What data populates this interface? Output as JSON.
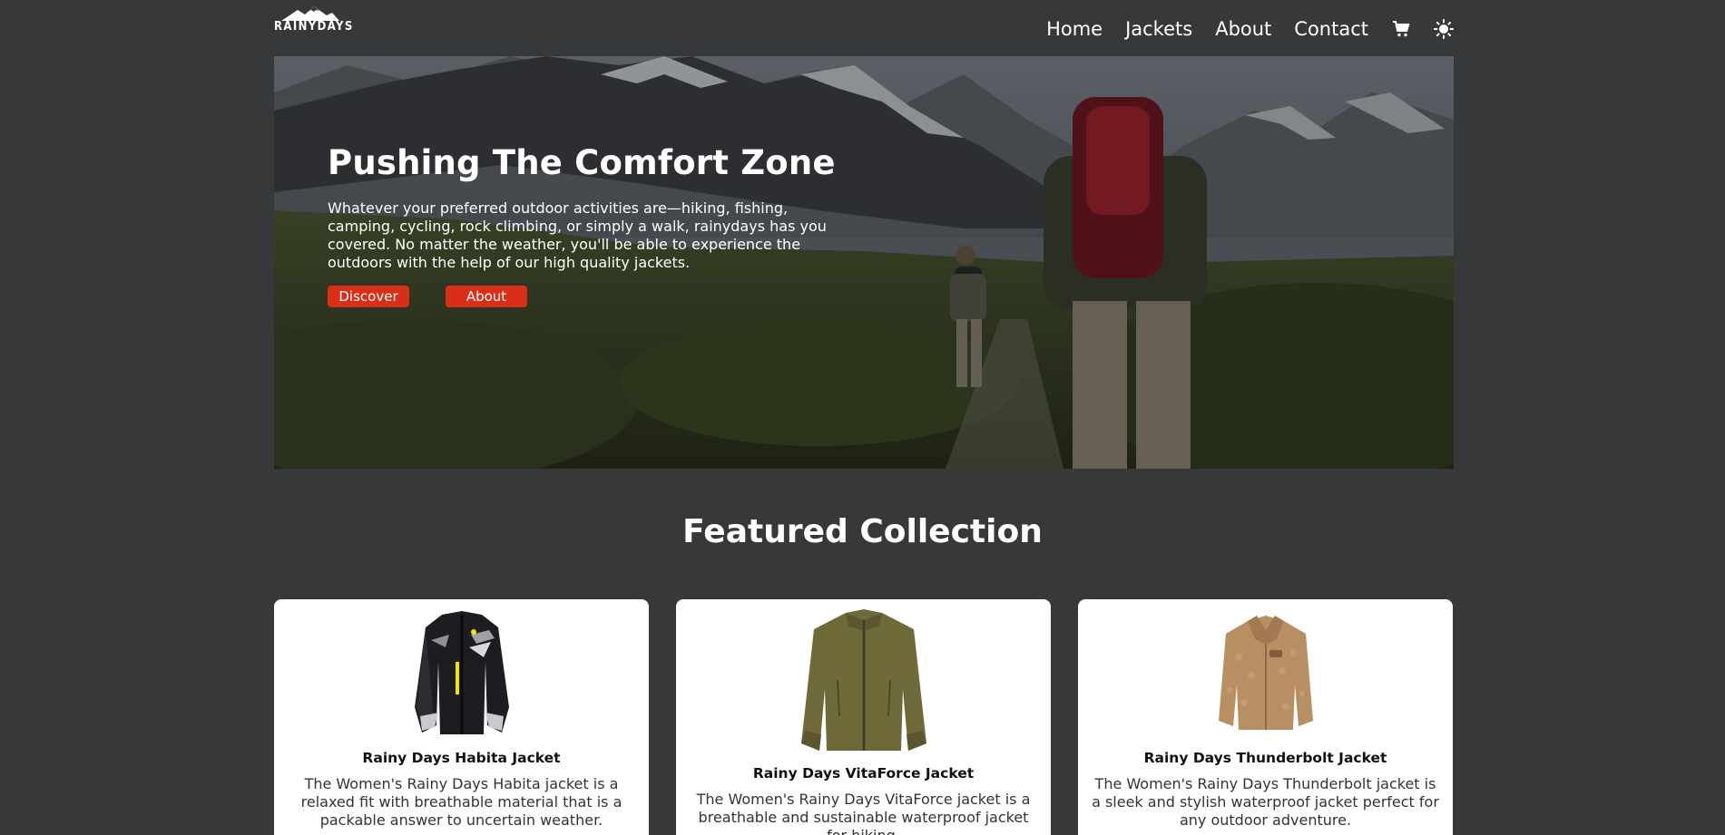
{
  "brand": {
    "logo_text": "RAINYDAYS"
  },
  "nav": {
    "items": [
      "Home",
      "Jackets",
      "About",
      "Contact"
    ],
    "cart_icon": "cart-icon",
    "theme_icon": "sun-icon"
  },
  "hero": {
    "title": "Pushing The Comfort Zone",
    "text": "Whatever your preferred outdoor activities are—hiking, fishing, camping, cycling, rock climbing, or simply a walk, rainydays has you covered. No matter the weather, you'll be able to experience the outdoors with the help of our high quality jackets.",
    "buttons": [
      "Discover",
      "About"
    ]
  },
  "featured": {
    "title": "Featured Collection",
    "products": [
      {
        "name": "Rainy Days Habita Jacket",
        "description": "The Women's Rainy Days Habita jacket is a relaxed fit with breathable material that is a packable answer to uncertain weather."
      },
      {
        "name": "Rainy Days VitaForce Jacket",
        "description": "The Women's Rainy Days VitaForce jacket is a breathable and sustainable waterproof jacket for hiking."
      },
      {
        "name": "Rainy Days Thunderbolt Jacket",
        "description": "The Women's Rainy Days Thunderbolt jacket is a sleek and stylish waterproof jacket perfect for any outdoor adventure."
      }
    ]
  },
  "colors": {
    "background": "#36383a",
    "accent": "#d92f16",
    "card": "#ffffff"
  }
}
